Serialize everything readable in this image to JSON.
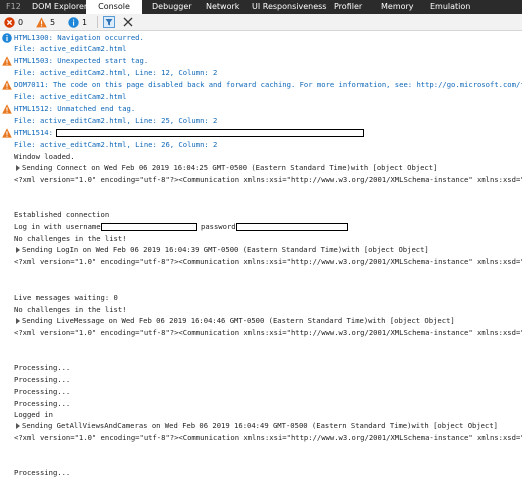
{
  "tabs": {
    "f12": "F12",
    "dom_explorer": "DOM Explorer",
    "console": "Console",
    "debugger": "Debugger",
    "network": "Network",
    "ui_responsiveness": "UI Responsiveness",
    "profiler": "Profiler",
    "memory": "Memory",
    "emulation": "Emulation"
  },
  "toolbar": {
    "error_count": "0",
    "warning_count": "5",
    "info_count": "1"
  },
  "console": {
    "msg1_code": "HTML1300:",
    "msg1_text": " Navigation occurred.",
    "msg1_file": "File: active_editCam2.html",
    "msg2_code": "HTML1503:",
    "msg2_text": " Unexpected start tag.",
    "msg2_file": "File: active_editCam2.html, Line: 12, Column: 2",
    "msg3_code": "DOM7011:",
    "msg3_text": " The code on this page disabled back and forward caching. For more information, see: http://go.microsoft.com/fwlink/?",
    "msg3_file": "File: active_editCam2.html",
    "msg4_code": "HTML1512:",
    "msg4_text": " Unmatched end tag.",
    "msg4_file": "File: active_editCam2.html, Line: 25, Column: 2",
    "msg5_code": "HTML1514:",
    "msg5_file": "File: active_editCam2.html, Line: 26, Column: 2",
    "window_loaded": "Window loaded.",
    "sending_connect": "Sending Connect on Wed Feb 06 2019 16:04:25 GMT-0500 (Eastern Standard Time)with  [object Object]",
    "xml1": "<?xml version=\"1.0\" encoding=\"utf-8\"?><Communication xmlns:xsi=\"http://www.w3.org/2001/XMLSchema-instance\" xmlns:xsd=\"http:/",
    "established": "Established connection",
    "login_prefix": "Log in with username",
    "password_label": "password",
    "no_challenges1": "No challenges in the list!",
    "sending_login": "Sending LogIn on Wed Feb 06 2019 16:04:39 GMT-0500 (Eastern Standard Time)with  [object Object]",
    "xml2": "<?xml version=\"1.0\" encoding=\"utf-8\"?><Communication xmlns:xsi=\"http://www.w3.org/2001/XMLSchema-instance\" xmlns:xsd=\"http:/",
    "live_waiting": "Live messages waiting: 0",
    "no_challenges2": "No challenges in the list!",
    "sending_live": "Sending LiveMessage on Wed Feb 06 2019 16:04:46 GMT-0500 (Eastern Standard Time)with  [object Object]",
    "xml3": "<?xml version=\"1.0\" encoding=\"utf-8\"?><Communication xmlns:xsi=\"http://www.w3.org/2001/XMLSchema-instance\" xmlns:xsd=\"http:/",
    "processing": "Processing...",
    "logged_in": "Logged in",
    "sending_getall": "Sending GetAllViewsAndCameras on Wed Feb 06 2019 16:04:49 GMT-0500 (Eastern Standard Time)with  [object Object]",
    "xml4": "<?xml version=\"1.0\" encoding=\"utf-8\"?><Communication xmlns:xsi=\"http://www.w3.org/2001/XMLSchema-instance\" xmlns:xsd=\"http:/"
  },
  "colors": {
    "tabbar_bg": "#2b2b2b",
    "message_blue": "#0f68b9",
    "warning_orange": "#e8771f",
    "error_red": "#d83b01",
    "info_blue": "#1e86d9"
  }
}
